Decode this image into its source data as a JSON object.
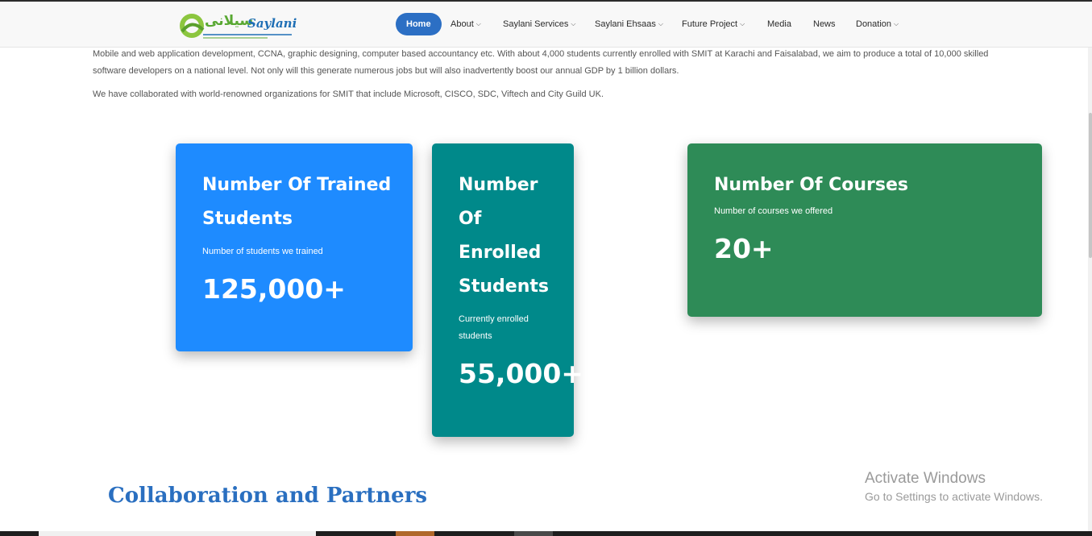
{
  "brand": {
    "logo_text": "Saylani",
    "logo_urdu": "سیلانی"
  },
  "nav": {
    "items": [
      {
        "label": "Home",
        "active": true,
        "dropdown": false
      },
      {
        "label": "About",
        "active": false,
        "dropdown": true
      },
      {
        "label": "Saylani Services",
        "active": false,
        "dropdown": true
      },
      {
        "label": "Saylani Ehsaas",
        "active": false,
        "dropdown": true
      },
      {
        "label": "Future Project",
        "active": false,
        "dropdown": true
      },
      {
        "label": "Media",
        "active": false,
        "dropdown": false
      },
      {
        "label": "News",
        "active": false,
        "dropdown": false
      },
      {
        "label": "Donation",
        "active": false,
        "dropdown": true
      }
    ]
  },
  "intro": {
    "paragraph1": "Mobile and web application development, CCNA, graphic designing, computer based accountancy etc. With about 4,000 students currently enrolled with SMIT at Karachi and Faisalabad, we aim to produce a total of 10,000 skilled software developers on a national level. Not only will this generate numerous jobs but will also inadvertently boost our annual GDP by 1 billion dollars.",
    "paragraph2": "We have collaborated with world-renowned organizations for SMIT that include Microsoft, CISCO, SDC, Viftech and City Guild UK."
  },
  "stats": {
    "trained": {
      "title": "Number Of Trained Students",
      "subtitle": "Number of students we trained",
      "value": "125,000+",
      "color": "#1e8bff"
    },
    "enrolled": {
      "title": "Number Of Enrolled Students",
      "subtitle": "Currently enrolled students",
      "value": "55,000+",
      "color": "#00898a"
    },
    "courses": {
      "title": "Number Of Courses",
      "subtitle": "Number of courses we offered",
      "value": "20+",
      "color": "#2e8b57"
    }
  },
  "collab_heading": "Collaboration and Partners",
  "watermark": {
    "line1": "Activate Windows",
    "line2": "Go to Settings to activate Windows."
  }
}
